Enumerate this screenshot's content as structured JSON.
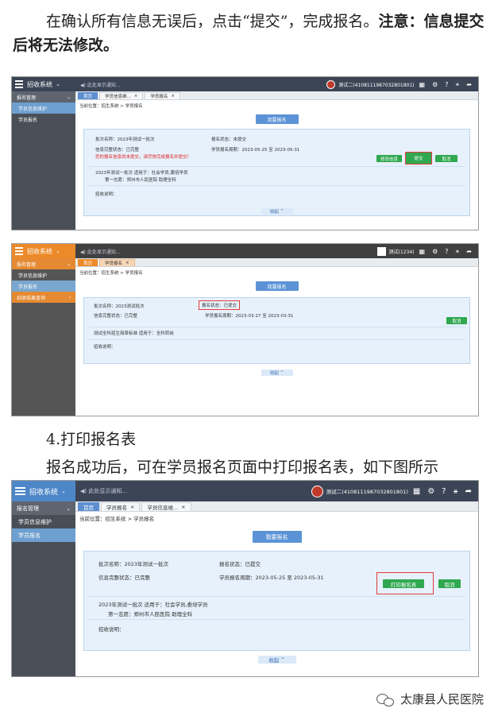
{
  "intro": {
    "text_normal": "在确认所有信息无误后，点击“提交”，完成报名。",
    "text_bold": "注意：信息提交后将无法修改。"
  },
  "section4": {
    "heading": "4.打印报名表",
    "text": "报名成功后，可在学员报名页面中打印报名表，如下图所示"
  },
  "watermark": "太康县人民医院",
  "shot1": {
    "logo": "招收系统",
    "notice": "此处显示通知...",
    "user": "测试二(4108111987032801801)",
    "sidebar": [
      "报名管理",
      "学员信息维护",
      "学员报名"
    ],
    "tabs": [
      "首页",
      "学员信息维...",
      "学员报名"
    ],
    "breadcrumb": "当前位置：招生系统 > 学员报名",
    "signup_btn": "我要报名",
    "batch_name": "批次名称：2023年测试一批次",
    "status": "报名状态：未提交",
    "info_complete": "信息完整状态：已完整",
    "signup_period": "学员报名周期：2023-05-25 至 2023-05-31",
    "warning": "您的报名信息尚未提交，请尽快完成报名并提交！",
    "batch_line": "2023年测试一批次 适用于：社会学员,委培学员",
    "choice": "第一志愿：郑州市人民医院      助理全科",
    "remark": "招收说明：",
    "btn_edit": "修改信息",
    "btn_submit": "提交",
    "btn_cancel": "取消",
    "collapse": "收起"
  },
  "shot2": {
    "logo": "招收系统",
    "notice": "此处显示通知...",
    "user": "测试(1234)",
    "sidebar": [
      "报名管理",
      "学员信息维护",
      "学员报名",
      "招收结果查询"
    ],
    "tabs": [
      "首页",
      "学员报名"
    ],
    "breadcrumb": "当前位置：招生系统 > 学员报名",
    "signup_btn": "我要报名",
    "batch_name": "批次名称：2023测试批次",
    "status": "报名状态：已提交",
    "info_complete": "信息完整状态：已完整",
    "signup_period": "学员报名周期：2023-03-27 至 2023-03-31",
    "batch_line": "测试全科招生简章标准 适用于：全科转岗",
    "remark": "招收说明：",
    "btn_cancel": "取消",
    "collapse": "收起"
  },
  "shot3": {
    "logo": "招收系统",
    "notice": "此处显示通知...",
    "user": "测试二(4108111987032801801)",
    "sidebar": [
      "报名管理",
      "学员信息维护",
      "学员报名"
    ],
    "tabs": [
      "首页",
      "学员报名",
      "学员信息维..."
    ],
    "breadcrumb": "当前位置：招生系统 > 学员报名",
    "signup_btn": "我要报名",
    "batch_name": "批次名称：2023年测试一批次",
    "status": "报名状态：已提交",
    "info_complete": "信息完整状态：已完整",
    "signup_period": "学员报名周期：2023-05-25 至 2023-05-31",
    "batch_line": "2023年测试一批次 适用于：社会学员,委培学员",
    "choice": "第一志愿：郑州市人民医院      助理全科",
    "remark": "招收说明：",
    "btn_print": "打印报名表",
    "btn_cancel": "取消",
    "collapse": "收起"
  }
}
